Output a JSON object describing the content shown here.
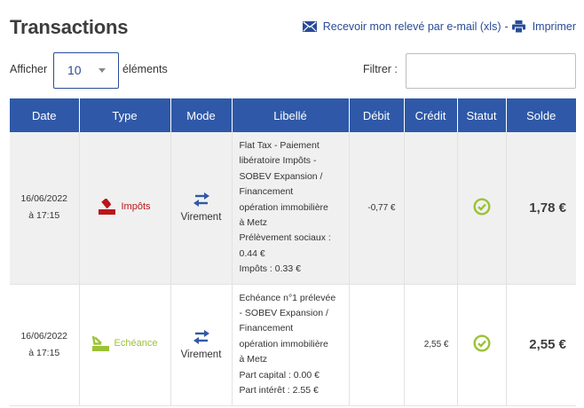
{
  "page": {
    "title": "Transactions",
    "email_link": "Recevoir mon relevé par e-mail (xls)",
    "separator": "-",
    "print_link": "Imprimer"
  },
  "controls": {
    "show_label": "Afficher",
    "page_size": "10",
    "elements_label": "éléments",
    "filter_label": "Filtrer :",
    "filter_value": ""
  },
  "table": {
    "headers": {
      "date": "Date",
      "type": "Type",
      "mode": "Mode",
      "libelle": "Libellé",
      "debit": "Débit",
      "credit": "Crédit",
      "statut": "Statut",
      "solde": "Solde"
    },
    "rows": [
      {
        "date": "16/06/2022",
        "time": "à 17:15",
        "type": "Impôts",
        "type_icon": "tax-icon",
        "type_color": "#b8161a",
        "mode": "Virement",
        "libelle": [
          "Flat Tax - Paiement",
          "libératoire Impôts -",
          "SOBEV Expansion /",
          "Financement",
          "opération immobilière",
          "à Metz",
          "Prélèvement sociaux :",
          "0.44 €",
          "Impôts : 0.33 €"
        ],
        "debit": "-0,77 €",
        "credit": "",
        "status_icon": "check-circle-icon",
        "solde": "1,78 €"
      },
      {
        "date": "16/06/2022",
        "time": "à 17:15",
        "type": "Echéance",
        "type_icon": "due-icon",
        "type_color": "#9cc235",
        "mode": "Virement",
        "libelle": [
          "Echéance n°1 prélevée",
          "- SOBEV Expansion /",
          "Financement",
          "opération immobilière",
          "à Metz",
          "Part capital : 0.00 €",
          "Part intérêt : 2.55 €"
        ],
        "debit": "",
        "credit": "2,55 €",
        "status_icon": "check-circle-icon",
        "solde": "2,55 €"
      }
    ]
  },
  "colors": {
    "accent": "#2f59a8",
    "link": "#2a4c97",
    "status_ok": "#9cc235"
  }
}
